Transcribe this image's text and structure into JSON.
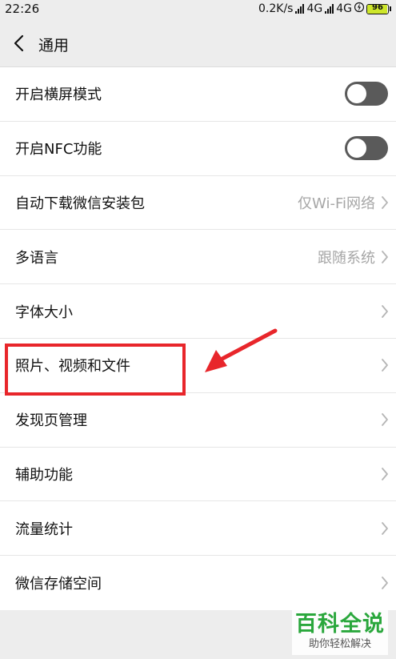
{
  "status_bar": {
    "time": "22:26",
    "speed": "0.2K/s",
    "network1": "4G",
    "network2": "4G",
    "battery": "96"
  },
  "nav": {
    "title": "通用"
  },
  "settings": {
    "items": [
      {
        "label": "开启横屏模式",
        "value": "",
        "control": "toggle",
        "toggle_on": false
      },
      {
        "label": "开启NFC功能",
        "value": "",
        "control": "toggle",
        "toggle_on": false
      },
      {
        "label": "自动下载微信安装包",
        "value": "仅Wi-Fi网络",
        "control": "chevron"
      },
      {
        "label": "多语言",
        "value": "跟随系统",
        "control": "chevron"
      },
      {
        "label": "字体大小",
        "value": "",
        "control": "chevron"
      },
      {
        "label": "照片、视频和文件",
        "value": "",
        "control": "chevron"
      },
      {
        "label": "发现页管理",
        "value": "",
        "control": "chevron"
      },
      {
        "label": "辅助功能",
        "value": "",
        "control": "chevron"
      },
      {
        "label": "流量统计",
        "value": "",
        "control": "chevron"
      },
      {
        "label": "微信存储空间",
        "value": "",
        "control": "chevron"
      }
    ]
  },
  "annotation": {
    "color": "#e8262b"
  },
  "watermark": {
    "title": "百科全说",
    "subtitle": "助你轻松解决"
  }
}
